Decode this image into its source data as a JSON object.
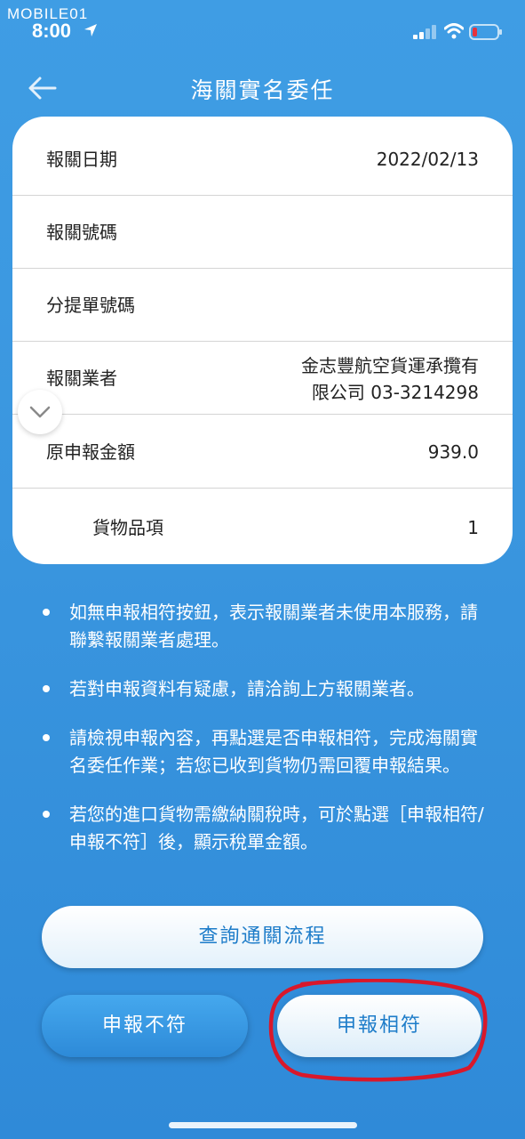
{
  "status_bar": {
    "watermark": "MOBILE01",
    "time": "8:00",
    "icons": [
      "location-arrow-icon",
      "cellular-signal-icon",
      "wifi-icon",
      "battery-low-icon"
    ]
  },
  "header": {
    "title": "海關實名委任",
    "back_icon": "arrow-left-icon"
  },
  "declaration": {
    "date_label": "報關日期",
    "date_value": "2022/02/13",
    "number_label": "報關號碼",
    "bill_label": "分提單號碼",
    "broker_label": "報關業者",
    "broker_value_line1": "金志豐航空貨運承攬有",
    "broker_value_line2": "限公司 03-3214298",
    "amount_label": "原申報金額",
    "amount_value": "939.0",
    "items_label": "貨物品項",
    "items_value": "1"
  },
  "notes": [
    "如無申報相符按鈕，表示報關業者未使用本服務，請聯繫報關業者處理。",
    "若對申報資料有疑慮，請洽詢上方報關業者。",
    "請檢視申報內容，再點選是否申報相符，完成海關實名委任作業；若您已收到貨物仍需回覆申報結果。",
    "若您的進口貨物需繳納關稅時，可於點選［申報相符/申報不符］後，顯示稅單金額。"
  ],
  "buttons": {
    "flow": "查詢通關流程",
    "mismatch": "申報不符",
    "match": "申報相符"
  },
  "colors": {
    "background": "#3a96df",
    "button_text": "#1d7cc9",
    "annotation": "#d9182b"
  }
}
